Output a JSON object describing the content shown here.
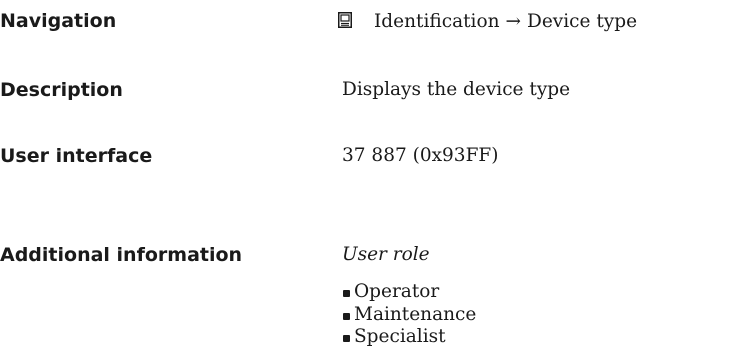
{
  "rows": {
    "navigation": {
      "label": "Navigation",
      "icon": "display-menu-icon",
      "path_start": "Identification",
      "arrow": "→",
      "path_end": "Device type"
    },
    "description": {
      "label": "Description",
      "value": "Displays the device type"
    },
    "user_interface": {
      "label": "User interface",
      "value": "37 887 (0x93FF)"
    },
    "additional_information": {
      "label": "Additional information",
      "subtitle": "User role",
      "roles": [
        "Operator",
        "Maintenance",
        "Specialist"
      ]
    }
  }
}
